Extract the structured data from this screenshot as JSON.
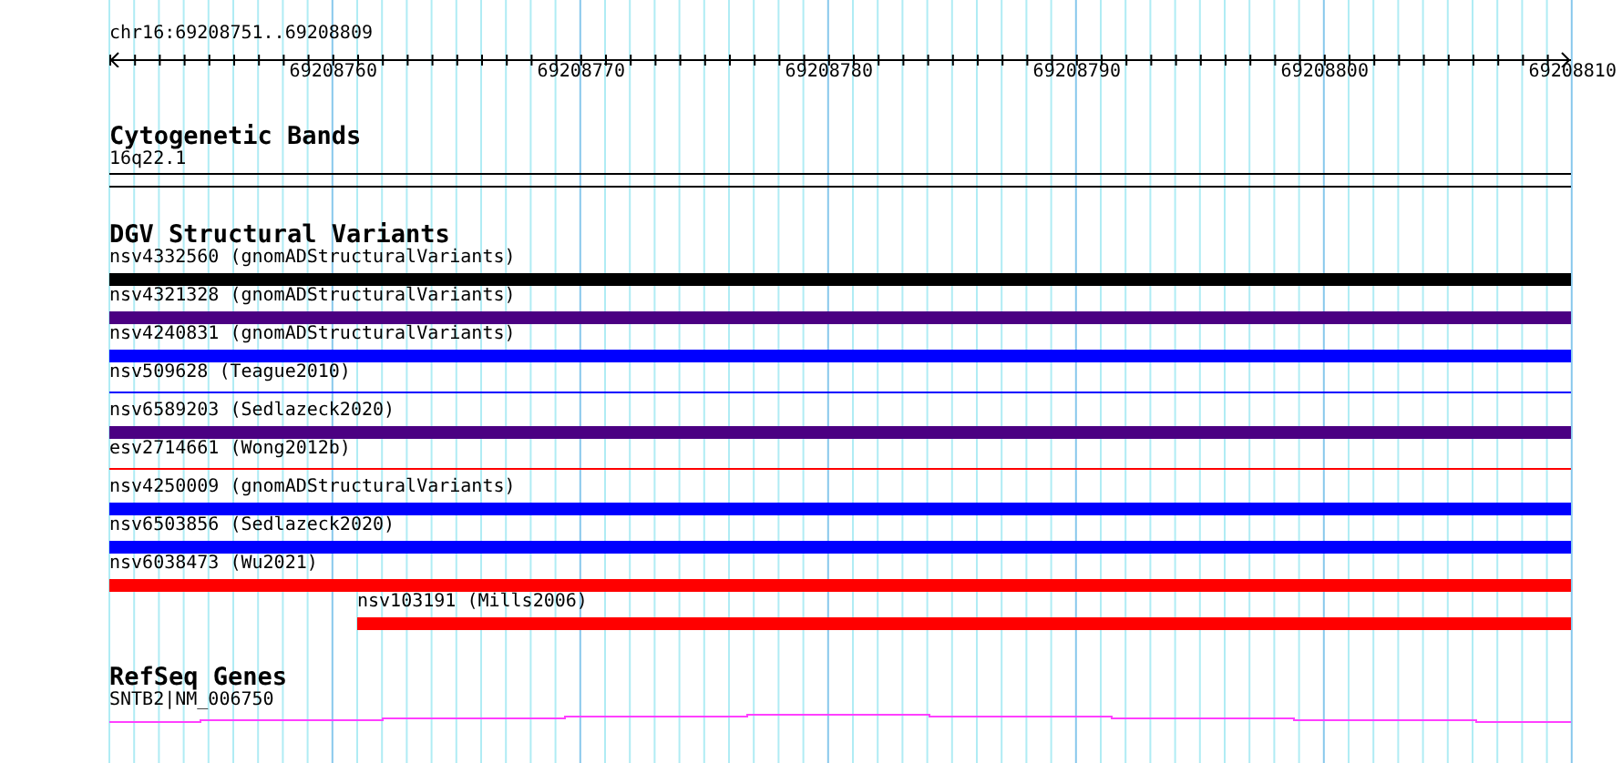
{
  "ruler": {
    "range": "chr16:69208751..69208809",
    "ticks": [
      "69208760",
      "69208770",
      "69208780",
      "69208790",
      "69208800",
      "69208810"
    ]
  },
  "cytogenetic_bands": {
    "title": "Cytogenetic Bands",
    "band": "16q22.1"
  },
  "dgv": {
    "title": "DGV Structural Variants",
    "variants": [
      {
        "label": "nsv4332560 (gnomADStructuralVariants)",
        "color": "#000000",
        "kind": "thick",
        "starts_in_view": false
      },
      {
        "label": "nsv4321328 (gnomADStructuralVariants)",
        "color": "#4b0082",
        "kind": "thick",
        "starts_in_view": false
      },
      {
        "label": "nsv4240831 (gnomADStructuralVariants)",
        "color": "#0000ff",
        "kind": "thick",
        "starts_in_view": false
      },
      {
        "label": "nsv509628 (Teague2010)",
        "color": "#0000ff",
        "kind": "thin",
        "starts_in_view": false
      },
      {
        "label": "nsv6589203 (Sedlazeck2020)",
        "color": "#4b0082",
        "kind": "thick",
        "starts_in_view": false
      },
      {
        "label": "esv2714661 (Wong2012b)",
        "color": "#ff0000",
        "kind": "thin",
        "starts_in_view": false
      },
      {
        "label": "nsv4250009 (gnomADStructuralVariants)",
        "color": "#0000ff",
        "kind": "thick",
        "starts_in_view": false
      },
      {
        "label": "nsv6503856 (Sedlazeck2020)",
        "color": "#0000ff",
        "kind": "thick",
        "starts_in_view": false
      },
      {
        "label": "nsv6038473 (Wu2021)",
        "color": "#ff0000",
        "kind": "thick",
        "starts_in_view": false
      },
      {
        "label": "nsv103191 (Mills2006)",
        "color": "#ff0000",
        "kind": "thick",
        "starts_in_view": true
      }
    ]
  },
  "refseq": {
    "title": "RefSeq Genes",
    "gene": "SNTB2|NM_006750"
  }
}
